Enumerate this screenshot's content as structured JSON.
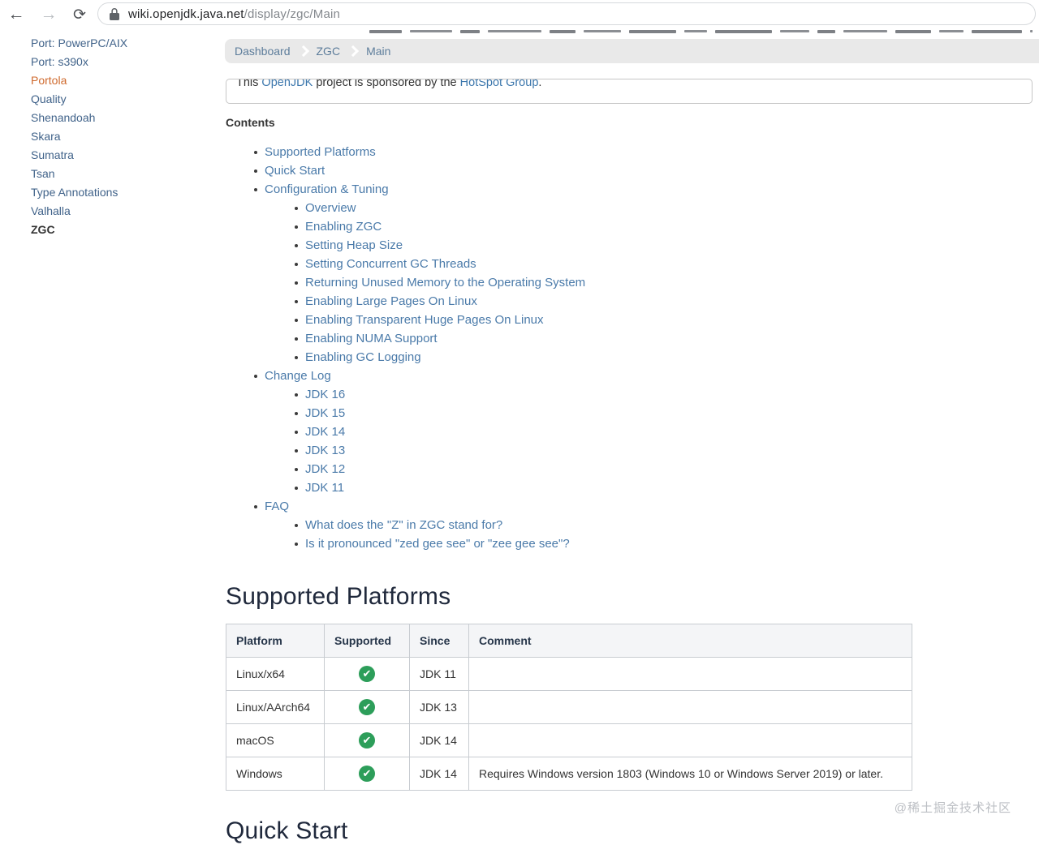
{
  "browser": {
    "url_host": "wiki.openjdk.java.net",
    "url_path": "/display/zgc/Main"
  },
  "icons": {
    "back": "←",
    "forward": "→",
    "reload": "⟳",
    "lock": "lock-icon",
    "check": "✔"
  },
  "colors": {
    "link_blue": "#4a7aa9",
    "sidebar_blue": "#41638a",
    "portola_orange": "#cf6a2e",
    "heading_navy": "#20293c",
    "check_green": "#2d9e5a",
    "breadcrumb_bg": "#e9e9e9"
  },
  "sidebar": {
    "items": [
      {
        "label": "Port: PowerPC/AIX",
        "style": ""
      },
      {
        "label": "Port: s390x",
        "style": ""
      },
      {
        "label": "Portola",
        "style": "highlight"
      },
      {
        "label": "Quality",
        "style": ""
      },
      {
        "label": "Shenandoah",
        "style": ""
      },
      {
        "label": "Skara",
        "style": ""
      },
      {
        "label": "Sumatra",
        "style": ""
      },
      {
        "label": "Tsan",
        "style": ""
      },
      {
        "label": "Type Annotations",
        "style": ""
      },
      {
        "label": "Valhalla",
        "style": ""
      },
      {
        "label": "ZGC",
        "style": "current"
      }
    ]
  },
  "breadcrumb": {
    "items": [
      "Dashboard",
      "ZGC",
      "Main"
    ]
  },
  "notice": {
    "prefix": "This ",
    "link1": "OpenJDK",
    "middle": " project is sponsored by the ",
    "link2": "HotSpot Group",
    "suffix": "."
  },
  "contents": {
    "heading": "Contents",
    "items": [
      {
        "label": "Supported Platforms",
        "level": 1
      },
      {
        "label": "Quick Start",
        "level": 1
      },
      {
        "label": "Configuration & Tuning",
        "level": 1
      },
      {
        "label": "Overview",
        "level": 2
      },
      {
        "label": "Enabling ZGC",
        "level": 2
      },
      {
        "label": "Setting Heap Size",
        "level": 2
      },
      {
        "label": "Setting Concurrent GC Threads",
        "level": 2
      },
      {
        "label": "Returning Unused Memory to the Operating System",
        "level": 2
      },
      {
        "label": "Enabling Large Pages On Linux",
        "level": 2
      },
      {
        "label": "Enabling Transparent Huge Pages On Linux",
        "level": 2
      },
      {
        "label": "Enabling NUMA Support",
        "level": 2
      },
      {
        "label": "Enabling GC Logging",
        "level": 2
      },
      {
        "label": "Change Log",
        "level": 1
      },
      {
        "label": "JDK 16",
        "level": 2
      },
      {
        "label": "JDK 15",
        "level": 2
      },
      {
        "label": "JDK 14",
        "level": 2
      },
      {
        "label": "JDK 13",
        "level": 2
      },
      {
        "label": "JDK 12",
        "level": 2
      },
      {
        "label": "JDK 11",
        "level": 2
      },
      {
        "label": "FAQ",
        "level": 1
      },
      {
        "label": "What does the \"Z\" in ZGC stand for?",
        "level": 2
      },
      {
        "label": "Is it pronounced \"zed gee see\" or \"zee gee see\"?",
        "level": 2
      }
    ]
  },
  "sections": {
    "supported_platforms_title": "Supported Platforms",
    "quick_start_title": "Quick Start"
  },
  "table": {
    "headers": [
      "Platform",
      "Supported",
      "Since",
      "Comment"
    ],
    "rows": [
      {
        "platform": "Linux/x64",
        "supported": true,
        "since": "JDK 11",
        "comment": ""
      },
      {
        "platform": "Linux/AArch64",
        "supported": true,
        "since": "JDK 13",
        "comment": ""
      },
      {
        "platform": "macOS",
        "supported": true,
        "since": "JDK 14",
        "comment": ""
      },
      {
        "platform": "Windows",
        "supported": true,
        "since": "JDK 14",
        "comment": "Requires Windows version 1803 (Windows 10 or Windows Server 2019) or later."
      }
    ]
  },
  "watermark": "@稀土掘金技术社区"
}
